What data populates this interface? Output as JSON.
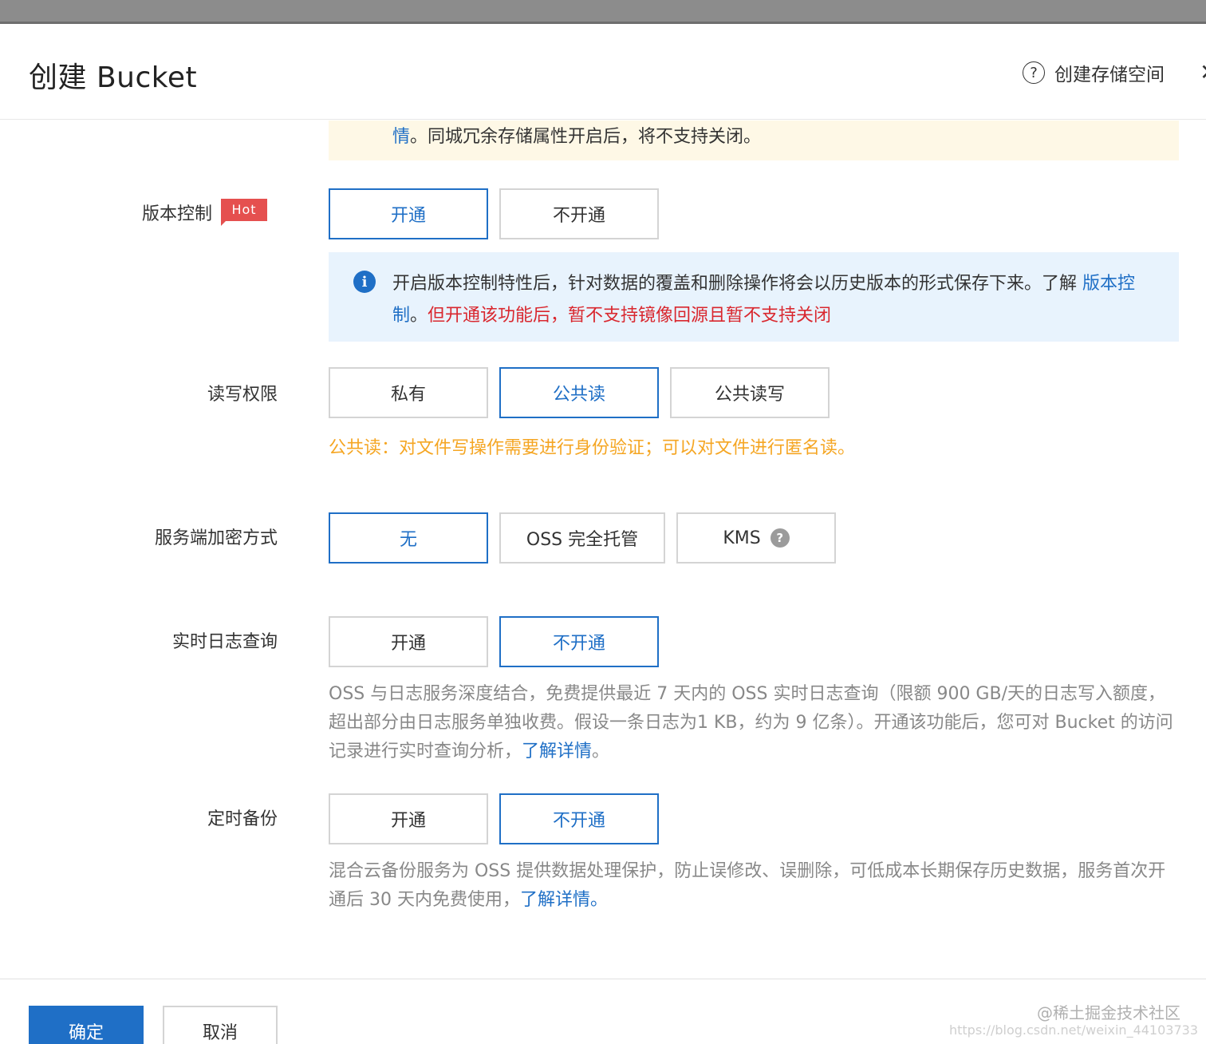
{
  "header": {
    "title": "创建 Bucket",
    "help_label": "创建存储空间"
  },
  "redundancy_notice": {
    "link_text": "情",
    "text": "。同城冗余存储属性开启后，将不支持关闭。"
  },
  "versioning": {
    "label": "版本控制",
    "tag": "Hot",
    "options": [
      "开通",
      "不开通"
    ],
    "selected": "开通",
    "info": {
      "text_before": "开启版本控制特性后，针对数据的覆盖和删除操作将会以历史版本的形式保存下来。了解 ",
      "link_text": "版本控制",
      "sep": "。",
      "warning": "但开通该功能后，暂不支持镜像回源且暂不支持关闭"
    }
  },
  "acl": {
    "label": "读写权限",
    "options": [
      "私有",
      "公共读",
      "公共读写"
    ],
    "selected": "公共读",
    "hint": "公共读：对文件写操作需要进行身份验证；可以对文件进行匿名读。"
  },
  "encryption": {
    "label": "服务端加密方式",
    "options": [
      "无",
      "OSS 完全托管",
      "KMS"
    ],
    "selected": "无"
  },
  "realtime_log": {
    "label": "实时日志查询",
    "options": [
      "开通",
      "不开通"
    ],
    "selected": "不开通",
    "desc": "OSS 与日志服务深度结合，免费提供最近 7 天内的 OSS 实时日志查询（限额 900 GB/天的日志写入额度，超出部分由日志服务单独收费。假设一条日志为1 KB，约为 9 亿条）。开通该功能后，您可对 Bucket 的访问记录进行实时查询分析，",
    "link_text": "了解详情",
    "end": "。"
  },
  "backup": {
    "label": "定时备份",
    "options": [
      "开通",
      "不开通"
    ],
    "selected": "不开通",
    "desc": "混合云备份服务为 OSS 提供数据处理保护，防止误修改、误删除，可低成本长期保存历史数据，服务首次开通后 30 天内免费使用，",
    "link_text": "了解详情。"
  },
  "footer": {
    "confirm": "确定",
    "cancel": "取消",
    "watermark": "@稀土掘金技术社区",
    "watermark_url": "https://blog.csdn.net/weixin_44103733"
  },
  "colors": {
    "primary": "#1f6fc6",
    "danger": "#d9272e",
    "warning_text": "#f5a623",
    "hot_tag": "#e5504f",
    "info_bg": "#e8f3fd",
    "notice_bg": "#fef8e6"
  }
}
